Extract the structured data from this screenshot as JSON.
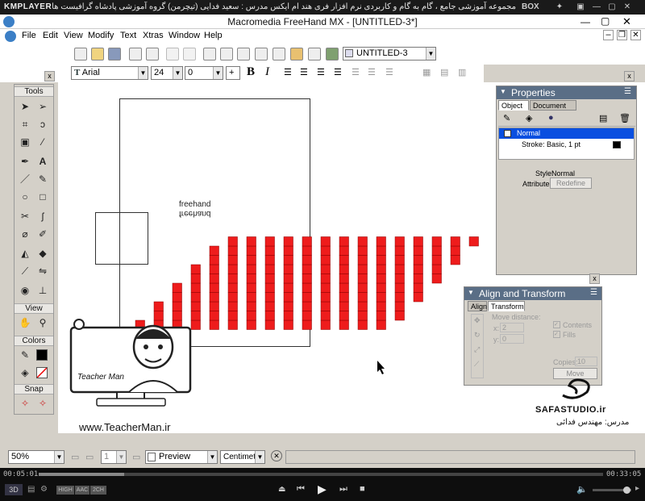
{
  "player": {
    "logo": "KMPLAYER",
    "caption": "مجموعه آموزشی جامع ، گام به گام و کاربردی نرم افزار فری هند ام ایکس  مدرس : سعید فدایی (تیچرمن) گروه آموزشی پادشاه گرافیست ها",
    "box_label": "BOX",
    "time_current": "00:05:01",
    "time_total": "00:33:05",
    "badges": [
      "HIGH",
      "AAC",
      "2CH"
    ],
    "mode_label": "3D"
  },
  "window": {
    "title": "Macromedia FreeHand MX - [UNTITLED-3*]"
  },
  "menu": [
    "File",
    "Edit",
    "View",
    "Modify",
    "Text",
    "Xtras",
    "Window",
    "Help"
  ],
  "toolbar": {
    "document_select": "UNTITLED-3"
  },
  "text_toolbar": {
    "font": "Arial",
    "size": "24",
    "leading": "0",
    "leading_mode": "+"
  },
  "tools": {
    "title": "Tools",
    "sections": [
      "View",
      "Colors",
      "Snap"
    ]
  },
  "properties": {
    "title": "Properties",
    "tabs": [
      "Object",
      "Document"
    ],
    "list": [
      "Normal",
      "Stroke: Basic, 1 pt"
    ],
    "style_label": "Style:",
    "style_value": "Normal",
    "attributes_label": "Attributes:",
    "redefine_button": "Redefine"
  },
  "align": {
    "title": "Align and Transform",
    "tabs": [
      "Align",
      "Transform"
    ],
    "move_label": "Move distance:",
    "x_label": "x:",
    "x_value": "2",
    "y_label": "y:",
    "y_value": "0",
    "contents_label": "Contents",
    "fills_label": "Fills",
    "copies_label": "Copies:",
    "copies_value": "10",
    "move_button": "Move"
  },
  "canvas": {
    "text_normal": "freehand",
    "text_flipped": "freehand"
  },
  "watermarks": {
    "teacher_site": "www.TeacherMan.ir",
    "teacher_name": "Teacher Man",
    "safa_site": "SAFASTUDIO.ir",
    "safa_credit": "مدرس: مهندس فدائی"
  },
  "status": {
    "zoom": "50%",
    "page": "1",
    "mode": "Preview",
    "units": "Centimeters"
  },
  "colors": {
    "checker_red": "#ee1c1c",
    "panel_head": "#5a6e86",
    "selected_row": "#0a4fe0"
  }
}
